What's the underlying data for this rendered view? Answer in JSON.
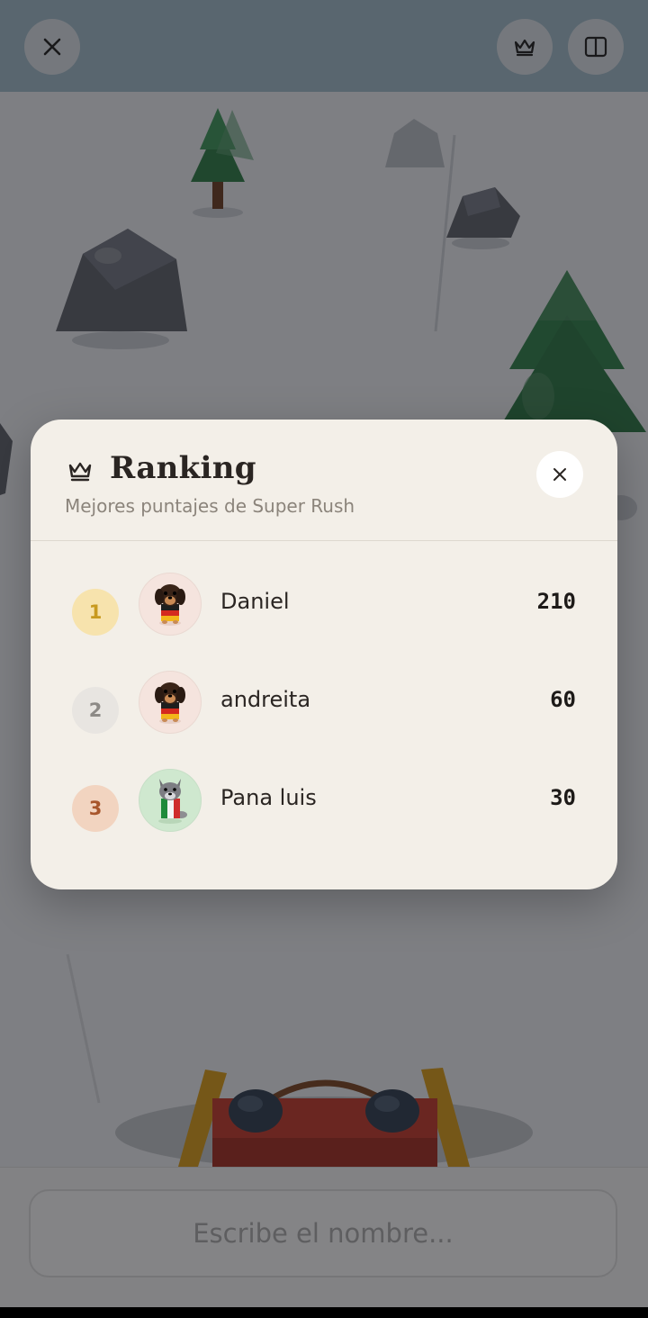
{
  "game": {
    "name_input_placeholder": "Escribe el nombre..."
  },
  "top_bar": {
    "close_icon": "close-icon",
    "ranking_icon": "crown-icon",
    "layout_icon": "split-view-icon"
  },
  "ranking_modal": {
    "title": "Ranking",
    "subtitle": "Mejores puntajes de Super Rush",
    "title_icon": "crown-icon",
    "close_icon": "close-icon",
    "entries": [
      {
        "rank": "1",
        "name": "Daniel",
        "score": "210",
        "avatar": "dachshund-germany-avatar"
      },
      {
        "rank": "2",
        "name": "andreita",
        "score": "60",
        "avatar": "dachshund-germany-avatar"
      },
      {
        "rank": "3",
        "name": "Pana luis",
        "score": "30",
        "avatar": "wolf-italy-avatar"
      }
    ]
  },
  "colors": {
    "modal_bg": "#f3efe8",
    "rank1_badge": "#f7e3ad",
    "rank1_text": "#c89a20",
    "rank2_badge": "#e8e5e1",
    "rank2_text": "#8d8a86",
    "rank3_badge": "#f2d4c0",
    "rank3_text": "#a8562c"
  }
}
